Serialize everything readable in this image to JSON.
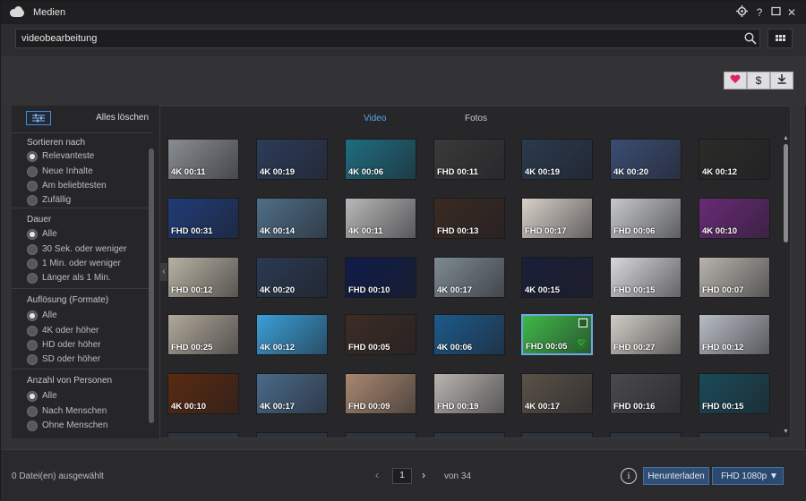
{
  "window": {
    "title": "Medien"
  },
  "search": {
    "value": "videobearbeitung"
  },
  "toolbar": {
    "buttons": [
      "heart-icon",
      "dollar-icon",
      "download-icon"
    ]
  },
  "tabs": {
    "video": "Video",
    "photos": "Fotos",
    "active": "Video"
  },
  "filters": {
    "clear_all": "Alles löschen",
    "sort": {
      "title": "Sortieren nach",
      "options": [
        "Relevanteste",
        "Neue Inhalte",
        "Am beliebtesten",
        "Zufällig"
      ],
      "selected": 0
    },
    "duration": {
      "title": "Dauer",
      "options": [
        "Alle",
        "30 Sek. oder weniger",
        "1 Min. oder weniger",
        "Länger als 1 Min."
      ],
      "selected": 0
    },
    "resolution": {
      "title": "Auflösung (Formate)",
      "options": [
        "Alle",
        "4K oder höher",
        "HD oder höher",
        "SD oder höher"
      ],
      "selected": 0
    },
    "people": {
      "title": "Anzahl von Personen",
      "options": [
        "Alle",
        "Nach Menschen",
        "Ohne Menschen"
      ],
      "selected": 0
    }
  },
  "thumbs": [
    [
      "4K 00:11",
      "4K 00:19",
      "4K 00:06",
      "FHD 00:11",
      "4K 00:19",
      "4K 00:20",
      "4K 00:12"
    ],
    [
      "FHD 00:31",
      "4K 00:14",
      "4K 00:11",
      "FHD 00:13",
      "FHD 00:17",
      "FHD 00:06",
      "4K 00:10"
    ],
    [
      "FHD 00:12",
      "4K 00:20",
      "FHD 00:10",
      "4K 00:17",
      "4K 00:15",
      "FHD 00:15",
      "FHD 00:07"
    ],
    [
      "FHD 00:25",
      "4K 00:12",
      "FHD 00:05",
      "4K 00:06",
      "FHD 00:05",
      "FHD 00:27",
      "FHD 00:12"
    ],
    [
      "4K 00:10",
      "4K 00:17",
      "FHD 00:09",
      "FHD 00:19",
      "4K 00:17",
      "FHD 00:16",
      "FHD 00:15"
    ]
  ],
  "thumb_colors": [
    [
      "#8a8d92",
      "#2d3c5a",
      "#1f6d80",
      "#3a3a3a",
      "#2a3a4e",
      "#3b4d73",
      "#2b2b28"
    ],
    [
      "#1f3c78",
      "#4f6f88",
      "#b8b8b8",
      "#3a2a22",
      "#d8d0c8",
      "#c6c8cc",
      "#6a2a78"
    ],
    [
      "#b8b2a2",
      "#2a3a52",
      "#0e1c4a",
      "#7e8a92",
      "#1a1f3a",
      "#d8d8dc",
      "#b8b4ac"
    ],
    [
      "#b0a89a",
      "#3a9fd8",
      "#3c2c24",
      "#1d5a8a",
      "#3fb848",
      "#d0ccc4",
      "#b8bcc4"
    ],
    [
      "#5a2a10",
      "#4a6a8a",
      "#a88870",
      "#b8b4b0",
      "#5a5248",
      "#4a4a4e",
      "#1a4a5a"
    ]
  ],
  "selected_thumb": [
    3,
    4
  ],
  "footer": {
    "selected_count": "0 Datei(en) ausgewählt",
    "page": "1",
    "of_pages": "von 34",
    "download": "Herunterladen",
    "quality": "FHD 1080p"
  }
}
